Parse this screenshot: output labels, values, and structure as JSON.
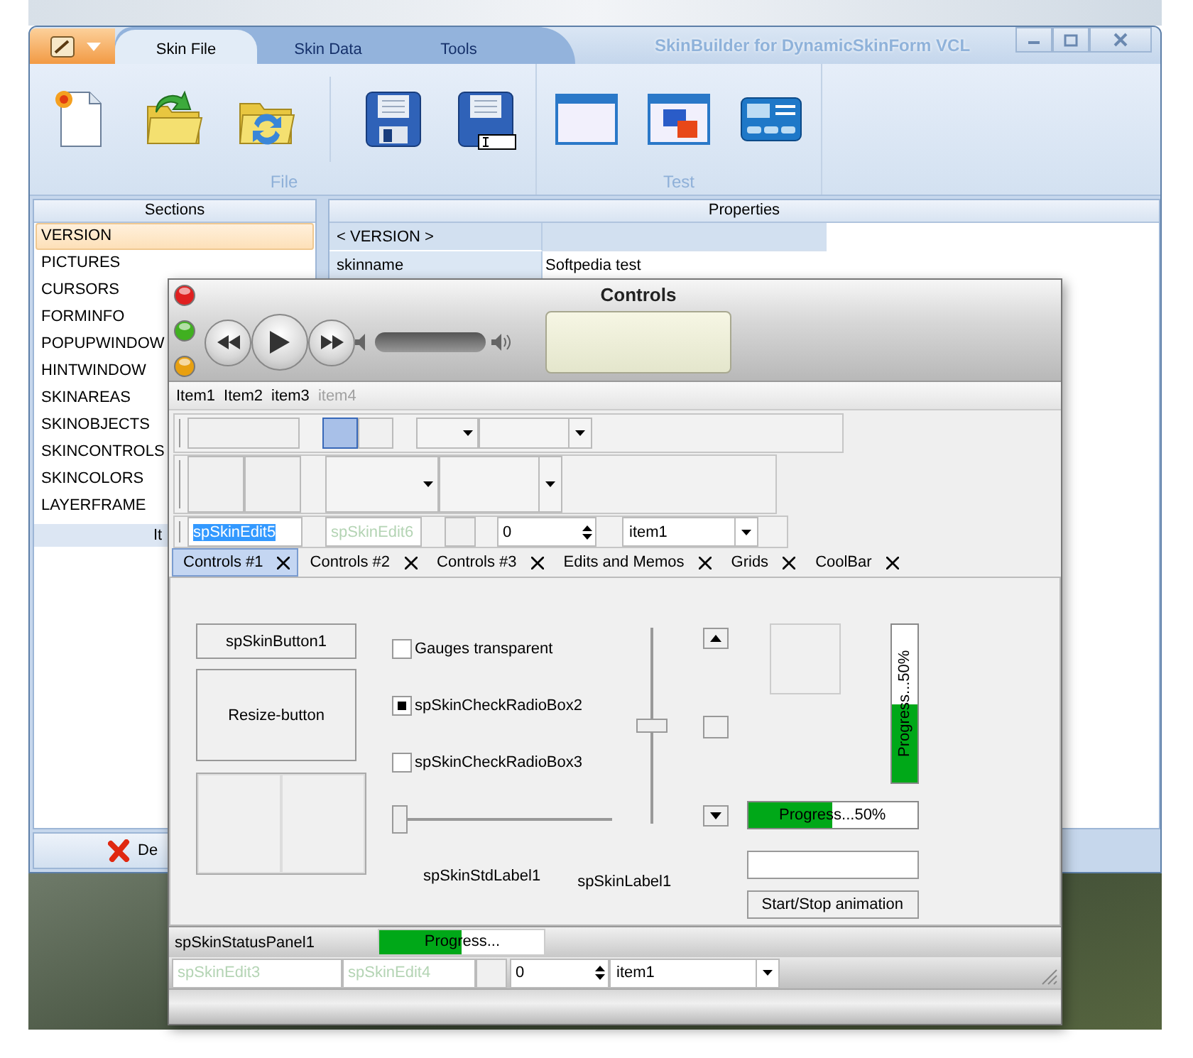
{
  "main_window": {
    "title": "SkinBuilder for DynamicSkinForm VCL",
    "tabs": [
      {
        "label": "Skin File",
        "selected": true
      },
      {
        "label": "Skin Data",
        "selected": false
      },
      {
        "label": "Tools",
        "selected": false
      }
    ],
    "ribbon_groups": [
      {
        "label": "File"
      },
      {
        "label": "Test"
      }
    ],
    "sections": {
      "header": "Sections",
      "items": [
        {
          "label": "VERSION",
          "selected": true
        },
        {
          "label": "PICTURES",
          "selected": false
        },
        {
          "label": "CURSORS",
          "selected": false
        },
        {
          "label": "FORMINFO",
          "selected": false
        },
        {
          "label": "POPUPWINDOW",
          "selected": false
        },
        {
          "label": "HINTWINDOW",
          "selected": false
        },
        {
          "label": "SKINAREAS",
          "selected": false
        },
        {
          "label": "SKINOBJECTS",
          "selected": false
        },
        {
          "label": "SKINCONTROLS",
          "selected": false
        },
        {
          "label": "SKINCOLORS",
          "selected": false
        },
        {
          "label": "LAYERFRAME",
          "selected": false
        }
      ],
      "footer": "It"
    },
    "properties": {
      "header": "Properties",
      "rows": [
        {
          "name": "< VERSION >"
        },
        {
          "name": "skinname",
          "value": "Softpedia test"
        }
      ]
    },
    "bottom_button": "De"
  },
  "controls_window": {
    "title": "Controls",
    "menu": [
      {
        "label": "Item1",
        "disabled": false
      },
      {
        "label": "Item2",
        "disabled": false
      },
      {
        "label": "item3",
        "disabled": false
      },
      {
        "label": "item4",
        "disabled": true
      }
    ],
    "toggle_buttons": [
      {
        "pressed": true
      },
      {
        "pressed": false
      }
    ],
    "edit_row": {
      "edits": [
        {
          "value": "spSkinEdit5",
          "highlighted": true,
          "disabled": false
        },
        {
          "value": "spSkinEdit6",
          "highlighted": false,
          "disabled": true
        }
      ],
      "spin": "0",
      "combo": "item1"
    },
    "tabs": [
      {
        "label": "Controls #1",
        "selected": true
      },
      {
        "label": "Controls #2",
        "selected": false
      },
      {
        "label": "Controls #3",
        "selected": false
      },
      {
        "label": "Edits and Memos",
        "selected": false
      },
      {
        "label": "Grids",
        "selected": false
      },
      {
        "label": "CoolBar",
        "selected": false
      }
    ],
    "buttons": [
      "spSkinButton1",
      "Resize-button"
    ],
    "checkboxes": [
      {
        "label": "Gauges transparent",
        "checked": false
      },
      {
        "label": "spSkinCheckRadioBox2",
        "checked": true
      },
      {
        "label": "spSkinCheckRadioBox3",
        "checked": false
      }
    ],
    "horizontal_slider": {
      "level": 0
    },
    "vertical_slider": {
      "level": 0.5
    },
    "labels": [
      "spSkinStdLabel1",
      "spSkinLabel1"
    ],
    "vertical_progress": {
      "label": "Progress...50%",
      "level": 0.5
    },
    "horizontal_progress": {
      "label": "Progress...50%",
      "level": 0.5
    },
    "animation_button": "Start/Stop animation",
    "status_bar": {
      "panel": "spSkinStatusPanel1",
      "progress": {
        "label": "Progress...",
        "level": 0.5
      }
    },
    "bottom_row": {
      "edits": [
        {
          "value": "spSkinEdit3",
          "highlighted": false,
          "disabled": true
        },
        {
          "value": "spSkinEdit4",
          "highlighted": false,
          "disabled": true
        }
      ],
      "spin": "0",
      "combo": "item1"
    }
  }
}
